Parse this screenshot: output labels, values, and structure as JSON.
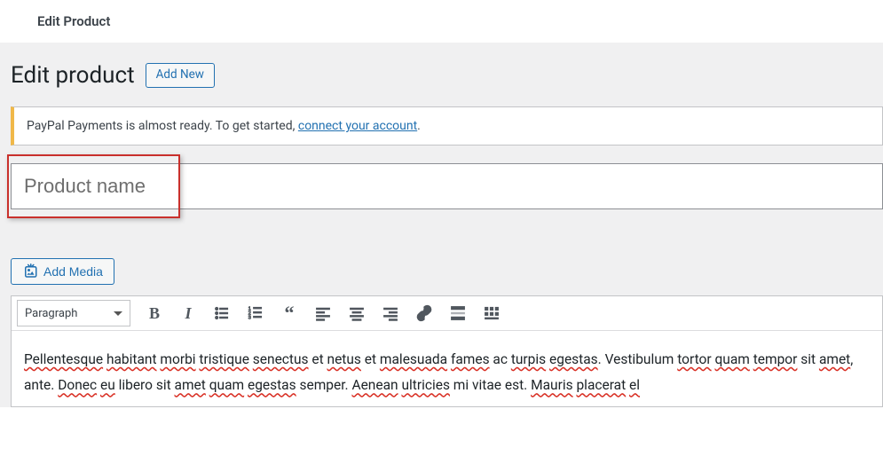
{
  "topbar": {
    "title": "Edit Product"
  },
  "heading": {
    "title": "Edit product",
    "add_new_label": "Add New"
  },
  "notice": {
    "text_before": "PayPal Payments is almost ready. To get started, ",
    "link_text": "connect your account",
    "text_after": "."
  },
  "title_field": {
    "placeholder": "Product name",
    "value": ""
  },
  "editor": {
    "add_media_label": "Add Media",
    "format_label": "Paragraph",
    "content_tokens": [
      {
        "t": "Pellentesque",
        "err": true
      },
      {
        "t": " "
      },
      {
        "t": "habitant",
        "err": true
      },
      {
        "t": " "
      },
      {
        "t": "morbi",
        "err": true
      },
      {
        "t": " "
      },
      {
        "t": "tristique",
        "err": true
      },
      {
        "t": " "
      },
      {
        "t": "senectus",
        "err": true
      },
      {
        "t": " et "
      },
      {
        "t": "netus",
        "err": true
      },
      {
        "t": " et "
      },
      {
        "t": "malesuada",
        "err": true
      },
      {
        "t": " "
      },
      {
        "t": "fames",
        "err": true
      },
      {
        "t": " ac "
      },
      {
        "t": "turpis",
        "err": true
      },
      {
        "t": " "
      },
      {
        "t": "egestas",
        "err": true
      },
      {
        "t": ". Vestibulum "
      },
      {
        "t": "tortor",
        "err": true
      },
      {
        "t": " "
      },
      {
        "t": "quam",
        "err": true
      },
      {
        "t": " "
      },
      {
        "t": "tempor",
        "err": true
      },
      {
        "t": " sit "
      },
      {
        "t": "amet",
        "err": true
      },
      {
        "t": ", ante. "
      },
      {
        "t": "Donec",
        "err": true
      },
      {
        "t": " "
      },
      {
        "t": "eu",
        "err": true
      },
      {
        "t": " libero sit "
      },
      {
        "t": "amet",
        "err": true
      },
      {
        "t": " "
      },
      {
        "t": "quam",
        "err": true
      },
      {
        "t": " "
      },
      {
        "t": "egestas",
        "err": true
      },
      {
        "t": " semper. "
      },
      {
        "t": "Aenean",
        "err": true
      },
      {
        "t": " "
      },
      {
        "t": "ultricies",
        "err": true
      },
      {
        "t": " mi vitae est. "
      },
      {
        "t": "Mauris",
        "err": true
      },
      {
        "t": " "
      },
      {
        "t": "placerat",
        "err": true
      },
      {
        "t": " "
      },
      {
        "t": "el",
        "err": true
      }
    ]
  }
}
